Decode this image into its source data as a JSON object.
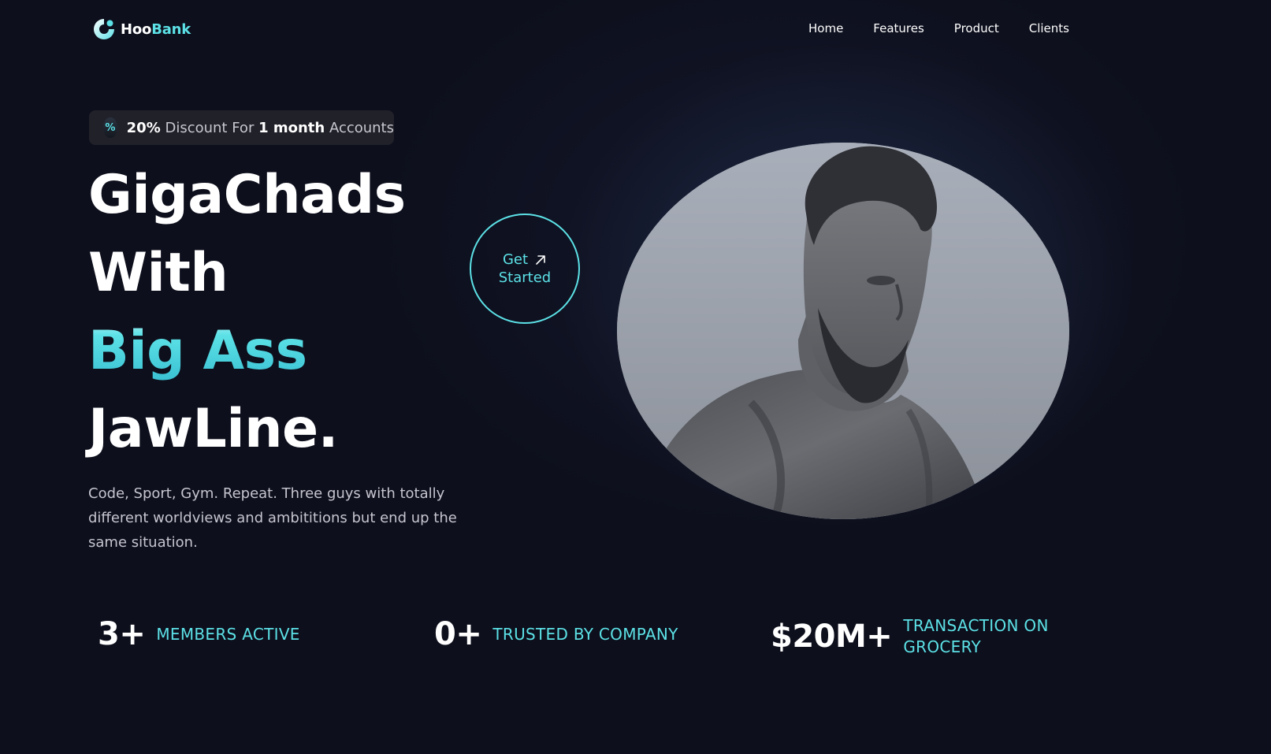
{
  "logo": {
    "part1": "Hoo",
    "part2": "Bank"
  },
  "nav": {
    "items": [
      "Home",
      "Features",
      "Product",
      "Clients"
    ]
  },
  "badge": {
    "percent": "20%",
    "mid": " Discount For ",
    "duration": "1 month",
    "suffix": " Accounts",
    "icon": "percent-icon"
  },
  "hero": {
    "line1": "GigaChads",
    "line2": "With",
    "line3": "Big Ass",
    "line4": "JawLine.",
    "description": "Code, Sport, Gym. Repeat. Three guys with totally different worldviews and ambititions but end up the same situation."
  },
  "cta": {
    "line1": "Get",
    "line2": "Started",
    "icon": "arrow-up-right-icon"
  },
  "stats": [
    {
      "value": "3+",
      "label": "MEMBERS ACTIVE"
    },
    {
      "value": "0+",
      "label": "TRUSTED BY COMPANY"
    },
    {
      "value": "$20M+",
      "label_line1": "TRANSACTION ON",
      "label_line2": "GROCERY"
    }
  ],
  "colors": {
    "accent": "#5ce1e6",
    "background": "#0d0f1c",
    "badge_bg": "#21212a"
  }
}
